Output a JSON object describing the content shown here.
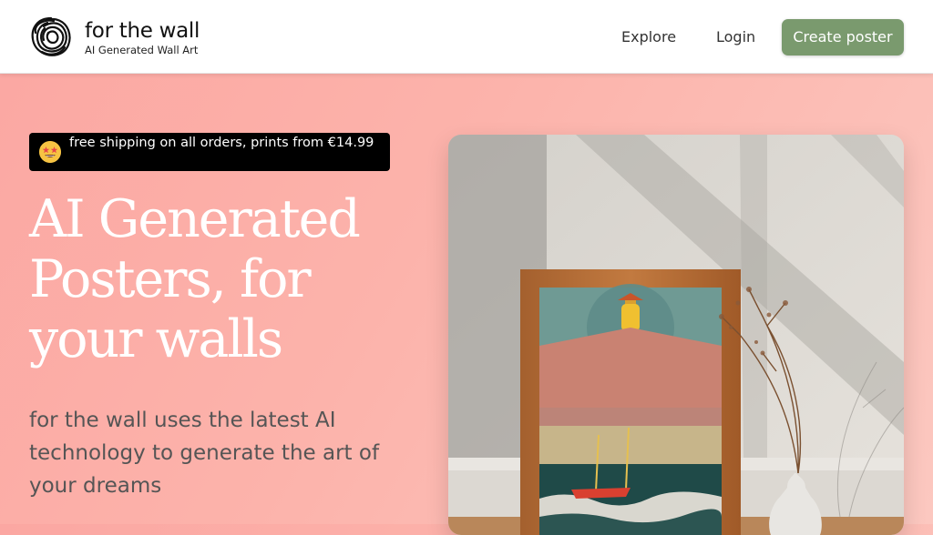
{
  "header": {
    "brand_name": "for the wall",
    "brand_tagline": "AI Generated Wall Art",
    "nav": [
      {
        "label": "Explore"
      },
      {
        "label": "Login"
      }
    ],
    "cta_label": "Create poster"
  },
  "promo": {
    "icon": "star-struck-emoji-icon",
    "text": "free shipping on all orders, prints from €14.99"
  },
  "hero": {
    "title": "AI Generated Posters, for your walls",
    "subtitle": "for the wall uses the latest AI technology to generate the art of your dreams"
  },
  "colors": {
    "accent_button": "#7a9a6e",
    "hero_background": "#fbaaa3",
    "badge_background": "#000000"
  }
}
